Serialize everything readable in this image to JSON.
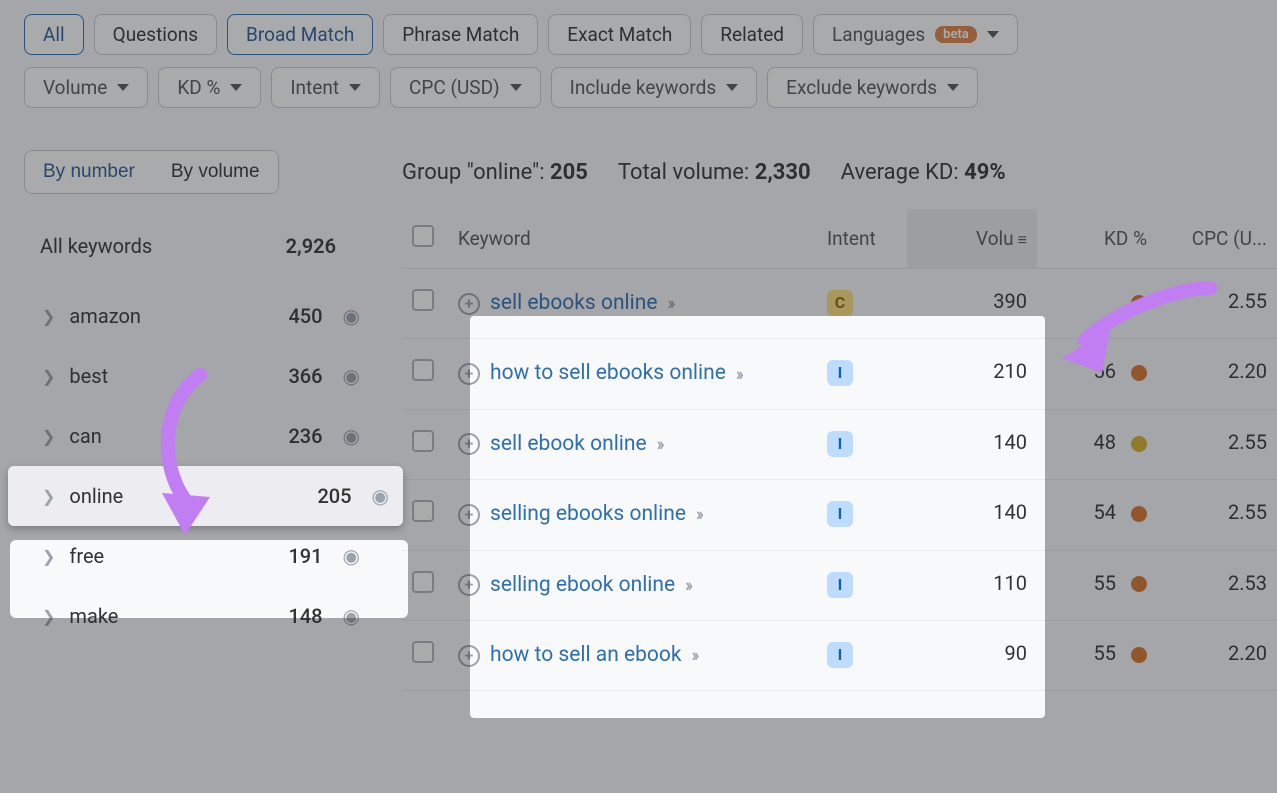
{
  "match_tabs": {
    "all": "All",
    "questions": "Questions",
    "broad": "Broad Match",
    "phrase": "Phrase Match",
    "exact": "Exact Match",
    "related": "Related"
  },
  "languages_button": {
    "label": "Languages",
    "badge": "beta"
  },
  "filters": {
    "volume": "Volume",
    "kd": "KD %",
    "intent": "Intent",
    "cpc": "CPC (USD)",
    "include": "Include keywords",
    "exclude": "Exclude keywords"
  },
  "sidebar": {
    "seg_by_number": "By number",
    "seg_by_volume": "By volume",
    "all_keywords_label": "All keywords",
    "all_keywords_count": "2,926",
    "groups": [
      {
        "label": "amazon",
        "count": "450"
      },
      {
        "label": "best",
        "count": "366"
      },
      {
        "label": "can",
        "count": "236"
      },
      {
        "label": "online",
        "count": "205",
        "highlight": true
      },
      {
        "label": "free",
        "count": "191"
      },
      {
        "label": "make",
        "count": "148"
      }
    ]
  },
  "summary": {
    "group_label": "Group \"online\": ",
    "group_count": "205",
    "total_volume_label": "Total volume: ",
    "total_volume": "2,330",
    "avg_kd_label": "Average KD: ",
    "avg_kd": "49%"
  },
  "columns": {
    "keyword": "Keyword",
    "intent": "Intent",
    "volume": "Volu",
    "kd": "KD %",
    "cpc": "CPC (U..."
  },
  "rows": [
    {
      "keyword": "sell ebooks online",
      "intent": "C",
      "volume": "390",
      "kd": "",
      "kd_color": "#d9742b",
      "cpc": "2.55"
    },
    {
      "keyword": "how to sell ebooks online",
      "intent": "I",
      "volume": "210",
      "kd": "56",
      "kd_color": "#d9742b",
      "cpc": "2.20"
    },
    {
      "keyword": "sell ebook online",
      "intent": "I",
      "volume": "140",
      "kd": "48",
      "kd_color": "#d6b12a",
      "cpc": "2.55"
    },
    {
      "keyword": "selling ebooks online",
      "intent": "I",
      "volume": "140",
      "kd": "54",
      "kd_color": "#d9742b",
      "cpc": "2.55"
    },
    {
      "keyword": "selling ebook online",
      "intent": "I",
      "volume": "110",
      "kd": "55",
      "kd_color": "#d9742b",
      "cpc": "2.53"
    },
    {
      "keyword": "how to sell an ebook",
      "intent": "I",
      "volume": "90",
      "kd": "55",
      "kd_color": "#d9742b",
      "cpc": "2.20"
    }
  ]
}
